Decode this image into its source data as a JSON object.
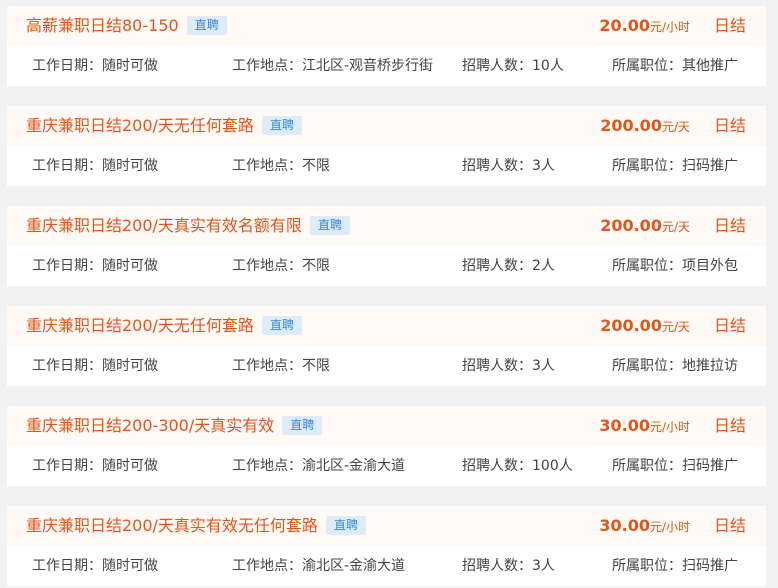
{
  "labels": {
    "date": "工作日期：",
    "location": "工作地点：",
    "headcount": "招聘人数：",
    "position": "所属职位："
  },
  "jobs": [
    {
      "title": "高薪兼职日结80-150",
      "badge": "直聘",
      "salary_amount": "20.00",
      "salary_unit": "元/小时",
      "settlement": "日结",
      "date": "随时可做",
      "location": "江北区-观音桥步行街",
      "headcount": "10人",
      "position": "其他推广"
    },
    {
      "title": "重庆兼职日结200/天无任何套路",
      "badge": "直聘",
      "salary_amount": "200.00",
      "salary_unit": "元/天",
      "settlement": "日结",
      "date": "随时可做",
      "location": "不限",
      "headcount": "3人",
      "position": "扫码推广"
    },
    {
      "title": "重庆兼职日结200/天真实有效名额有限",
      "badge": "直聘",
      "salary_amount": "200.00",
      "salary_unit": "元/天",
      "settlement": "日结",
      "date": "随时可做",
      "location": "不限",
      "headcount": "2人",
      "position": "项目外包"
    },
    {
      "title": "重庆兼职日结200/天无任何套路",
      "badge": "直聘",
      "salary_amount": "200.00",
      "salary_unit": "元/天",
      "settlement": "日结",
      "date": "随时可做",
      "location": "不限",
      "headcount": "3人",
      "position": "地推拉访"
    },
    {
      "title": "重庆兼职日结200-300/天真实有效",
      "badge": "直聘",
      "salary_amount": "30.00",
      "salary_unit": "元/小时",
      "settlement": "日结",
      "date": "随时可做",
      "location": "渝北区-金渝大道",
      "headcount": "100人",
      "position": "扫码推广"
    },
    {
      "title": "重庆兼职日结200/天真实有效无任何套路",
      "badge": "直聘",
      "salary_amount": "30.00",
      "salary_unit": "元/小时",
      "settlement": "日结",
      "date": "随时可做",
      "location": "渝北区-金渝大道",
      "headcount": "3人",
      "position": "扫码推广"
    }
  ]
}
